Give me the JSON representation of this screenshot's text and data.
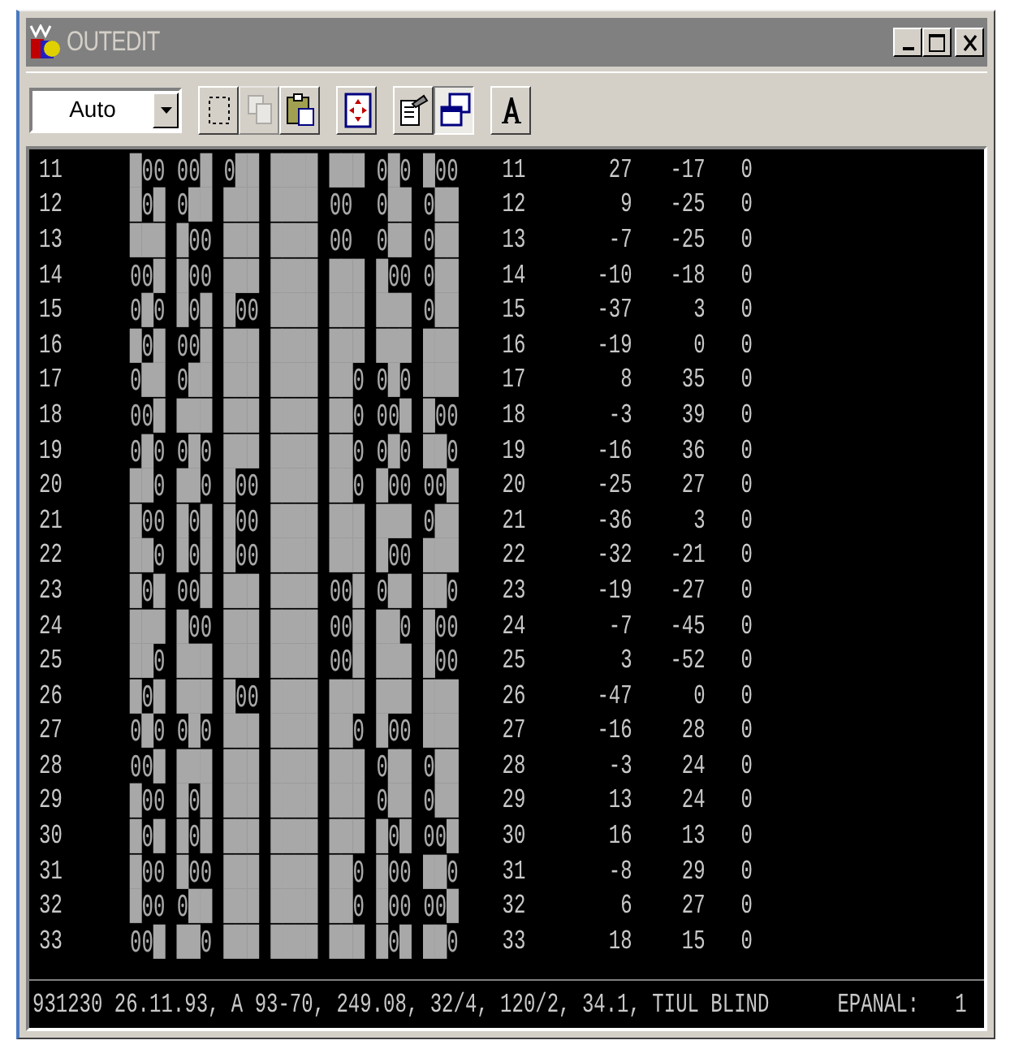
{
  "window": {
    "title": "OUTEDIT"
  },
  "toolbar": {
    "zoom_select": {
      "value": "Auto"
    },
    "buttons": [
      {
        "kind": "select",
        "pressed": false,
        "disabled": false
      },
      {
        "kind": "copy",
        "pressed": false,
        "disabled": true
      },
      {
        "kind": "paste",
        "pressed": false,
        "disabled": false
      },
      {
        "kind": "fit",
        "pressed": false,
        "disabled": false
      },
      {
        "kind": "properties",
        "pressed": false,
        "disabled": false
      },
      {
        "kind": "window",
        "pressed": true,
        "disabled": false
      },
      {
        "kind": "font",
        "pressed": false,
        "disabled": false
      }
    ]
  },
  "rows": [
    {
      "number": "11",
      "cells": "█00 00█ 0██ ████ ███ 0█0 █00",
      "number_2": "11",
      "column_1": "27",
      "column_2": "-17",
      "column_3": "0"
    },
    {
      "number": "12",
      "cells": "█0█ 0██ ███ ████ 00  0██ 0██",
      "number_2": "12",
      "column_1": "9",
      "column_2": "-25",
      "column_3": "0"
    },
    {
      "number": "13",
      "cells": "███ █00 ███ ████ 00  0██ 0██",
      "number_2": "13",
      "column_1": "-7",
      "column_2": "-25",
      "column_3": "0"
    },
    {
      "number": "14",
      "cells": "00█ █00 ███ ████ ███ █00 0██",
      "number_2": "14",
      "column_1": "-10",
      "column_2": "-18",
      "column_3": "0"
    },
    {
      "number": "15",
      "cells": "0█0 █0█ █00 ████ ███ ███ 0██",
      "number_2": "15",
      "column_1": "-37",
      "column_2": "3",
      "column_3": "0"
    },
    {
      "number": "16",
      "cells": "█0█ 00█ ███ ████ ███ ███ ███",
      "number_2": "16",
      "column_1": "-19",
      "column_2": "0",
      "column_3": "0"
    },
    {
      "number": "17",
      "cells": "0██ 0██ ███ ████ ██0 0█0 ███",
      "number_2": "17",
      "column_1": "8",
      "column_2": "35",
      "column_3": "0"
    },
    {
      "number": "18",
      "cells": "00█ ███ ███ ████ ██0 00█ █00",
      "number_2": "18",
      "column_1": "-3",
      "column_2": "39",
      "column_3": "0"
    },
    {
      "number": "19",
      "cells": "0█0 0█0 ███ ████ ██0 0█0 ██0",
      "number_2": "19",
      "column_1": "-16",
      "column_2": "36",
      "column_3": "0"
    },
    {
      "number": "20",
      "cells": "██0 ██0 █00 ████ ██0 █00 00█",
      "number_2": "20",
      "column_1": "-25",
      "column_2": "27",
      "column_3": "0"
    },
    {
      "number": "21",
      "cells": "█00 █0█ █00 ████ ███ ███ 0██",
      "number_2": "21",
      "column_1": "-36",
      "column_2": "3",
      "column_3": "0"
    },
    {
      "number": "22",
      "cells": "██0 █0█ █00 ████ ███ █00 ███",
      "number_2": "22",
      "column_1": "-32",
      "column_2": "-21",
      "column_3": "0"
    },
    {
      "number": "23",
      "cells": "█0█ 00█ ███ ████ 00█ 0██ ██0",
      "number_2": "23",
      "column_1": "-19",
      "column_2": "-27",
      "column_3": "0"
    },
    {
      "number": "24",
      "cells": "███ █00 ███ ████ 00█ ██0 █00",
      "number_2": "24",
      "column_1": "-7",
      "column_2": "-45",
      "column_3": "0"
    },
    {
      "number": "25",
      "cells": "██0 ███ ███ ████ 00█ ███ █00",
      "number_2": "25",
      "column_1": "3",
      "column_2": "-52",
      "column_3": "0"
    },
    {
      "number": "26",
      "cells": "█0█ ███ █00 ████ ███ ███ ███",
      "number_2": "26",
      "column_1": "-47",
      "column_2": "0",
      "column_3": "0"
    },
    {
      "number": "27",
      "cells": "0█0 0█0 ███ ████ ██0 █00 ███",
      "number_2": "27",
      "column_1": "-16",
      "column_2": "28",
      "column_3": "0"
    },
    {
      "number": "28",
      "cells": "00█ ███ ███ ████ ███ 0██ 0██",
      "number_2": "28",
      "column_1": "-3",
      "column_2": "24",
      "column_3": "0"
    },
    {
      "number": "29",
      "cells": "█00 █0█ ███ ████ ███ 0██ 0██",
      "number_2": "29",
      "column_1": "13",
      "column_2": "24",
      "column_3": "0"
    },
    {
      "number": "30",
      "cells": "█0█ █0█ ███ ████ ███ █0█ 00█",
      "number_2": "30",
      "column_1": "16",
      "column_2": "13",
      "column_3": "0"
    },
    {
      "number": "31",
      "cells": "█00 █00 ███ ████ ██0 █00 ██0",
      "number_2": "31",
      "column_1": "-8",
      "column_2": "29",
      "column_3": "0"
    },
    {
      "number": "32",
      "cells": "█00 0██ ███ ████ ██0 █00 00█",
      "number_2": "32",
      "column_1": "6",
      "column_2": "27",
      "column_3": "0"
    },
    {
      "number": "33",
      "cells": "00█ ██0 ███ ████ ███ █0█ ██0",
      "number_2": "33",
      "column_1": "18",
      "column_2": "15",
      "column_3": "0"
    }
  ],
  "status_bar": {
    "text": "931230 26.11.93, A 93-70, 249.08, 32/4, 120/2, 34.1, TIUL BLIND",
    "label": "EPANAL:",
    "value": "1"
  }
}
